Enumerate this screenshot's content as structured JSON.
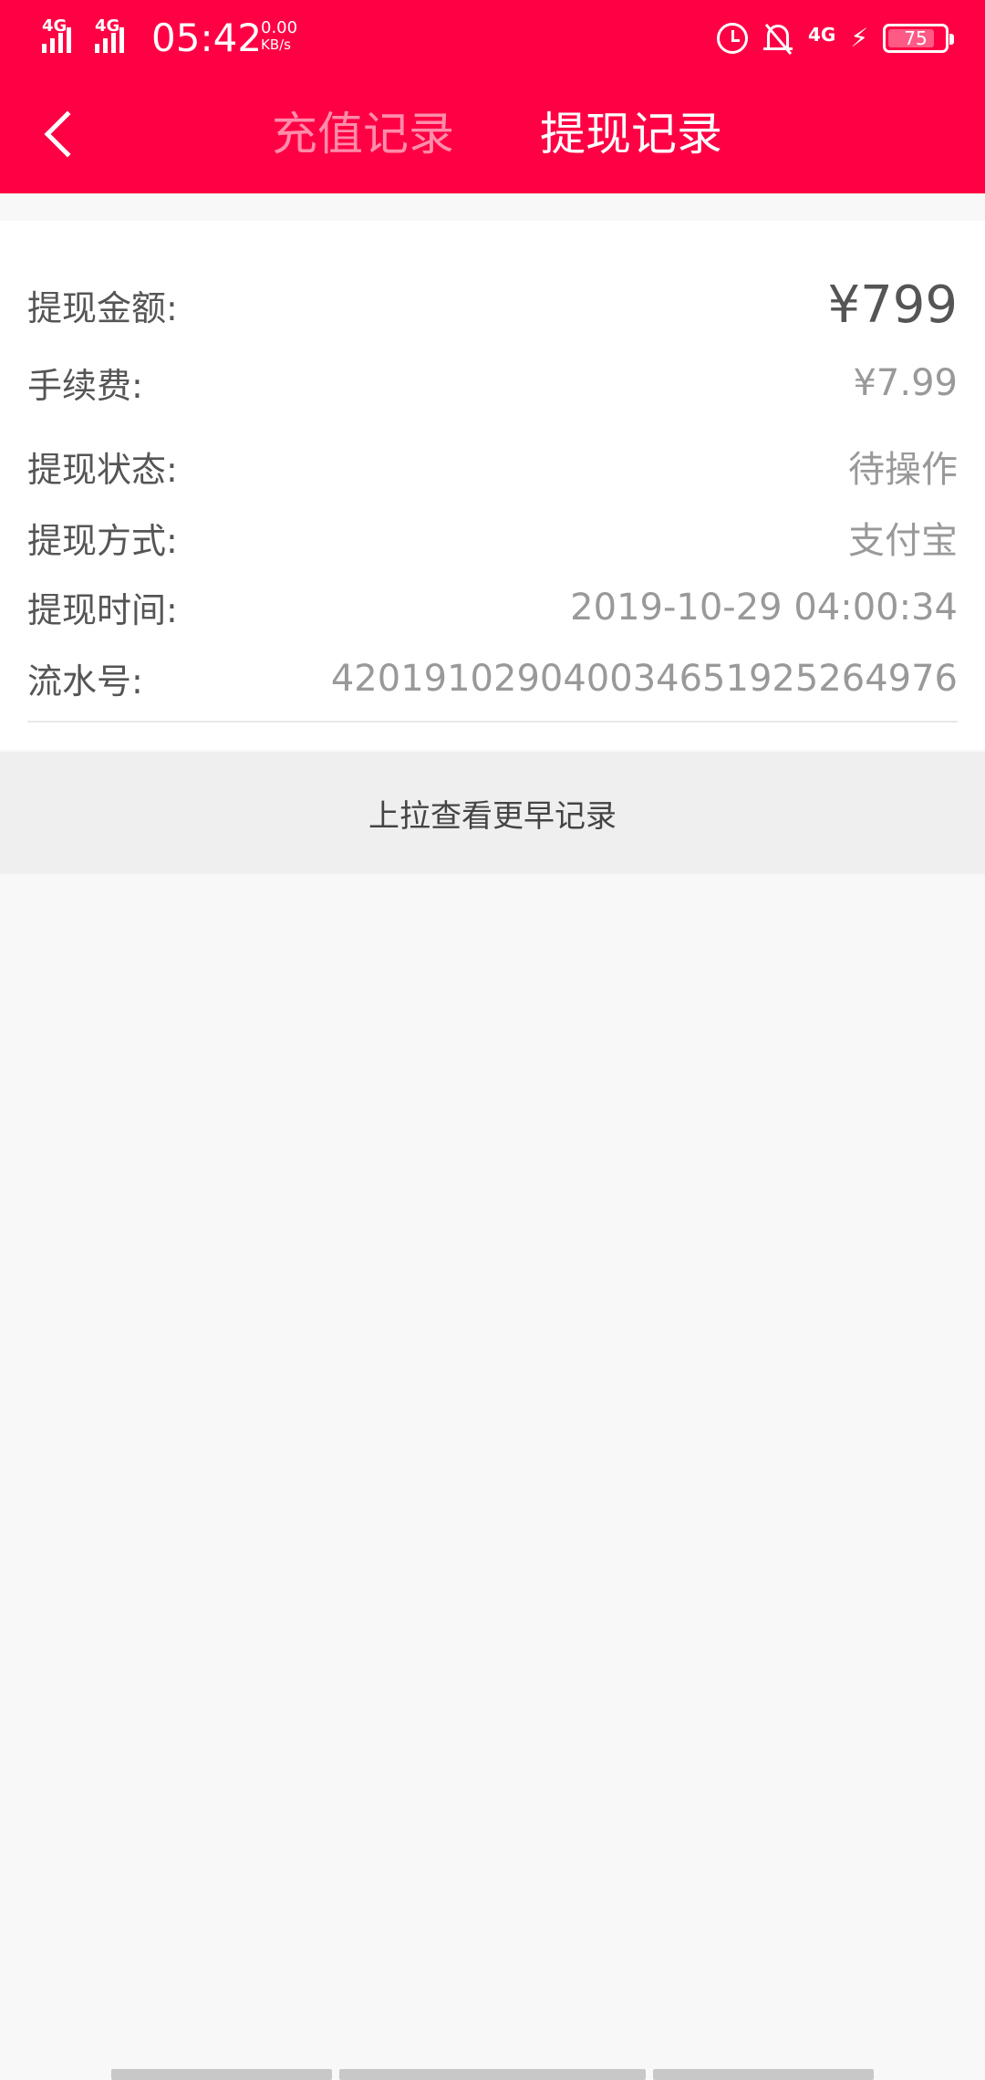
{
  "status_bar": {
    "network_left": "4G",
    "network_left2": "4G",
    "time": "05:42",
    "speed_value": "0.00",
    "speed_unit": "KB/s",
    "network_right": "4G",
    "battery": "75"
  },
  "header": {
    "tabs": [
      {
        "label": "充值记录",
        "active": false
      },
      {
        "label": "提现记录",
        "active": true
      }
    ]
  },
  "record": {
    "rows": [
      {
        "label": "提现金额:",
        "value": "¥799"
      },
      {
        "label": "手续费:",
        "value": "¥7.99"
      },
      {
        "label": "提现状态:",
        "value": "待操作"
      },
      {
        "label": "提现方式:",
        "value": "支付宝"
      },
      {
        "label": "提现时间:",
        "value": "2019-10-29 04:00:34"
      },
      {
        "label": "流水号:",
        "value": "420191029040034651925264976"
      }
    ]
  },
  "pull_hint": "上拉查看更早记录",
  "colors": {
    "accent": "#ff0044",
    "background": "#f8f8f8"
  }
}
